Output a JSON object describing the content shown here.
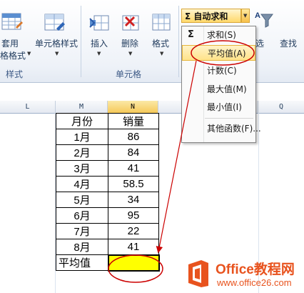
{
  "ribbon": {
    "format_table_line1": "套用",
    "format_table_line2": "格格式",
    "cell_styles": "单元格样式",
    "insert": "插入",
    "delete": "删除",
    "format": "格式",
    "styles_group": "样式",
    "cells_group": "单元格",
    "autosum": "Σ 自动求和",
    "filter_partial": "选",
    "find_partial": "查找"
  },
  "menu": {
    "sigma": "Σ",
    "items": [
      {
        "label": "求和(S)"
      },
      {
        "label": "平均值(A)"
      },
      {
        "label": "计数(C)"
      },
      {
        "label": "最大值(M)"
      },
      {
        "label": "最小值(I)"
      },
      {
        "label": "其他函数(F)..."
      }
    ]
  },
  "columns": [
    "L",
    "M",
    "N",
    "Q"
  ],
  "table": {
    "header": [
      "月份",
      "销量"
    ],
    "rows": [
      [
        "1月",
        "86"
      ],
      [
        "2月",
        "84"
      ],
      [
        "3月",
        "41"
      ],
      [
        "4月",
        "58.5"
      ],
      [
        "5月",
        "34"
      ],
      [
        "6月",
        "95"
      ],
      [
        "7月",
        "22"
      ],
      [
        "8月",
        "41"
      ]
    ],
    "footer_label": "平均值",
    "footer_value": ""
  },
  "watermark": {
    "line1": "Office教程网",
    "line2": "www.office26.com"
  },
  "colors": {
    "selected_cell": "#ffff00",
    "annotation_red": "#cc0000",
    "logo_orange": "#e8531e"
  }
}
